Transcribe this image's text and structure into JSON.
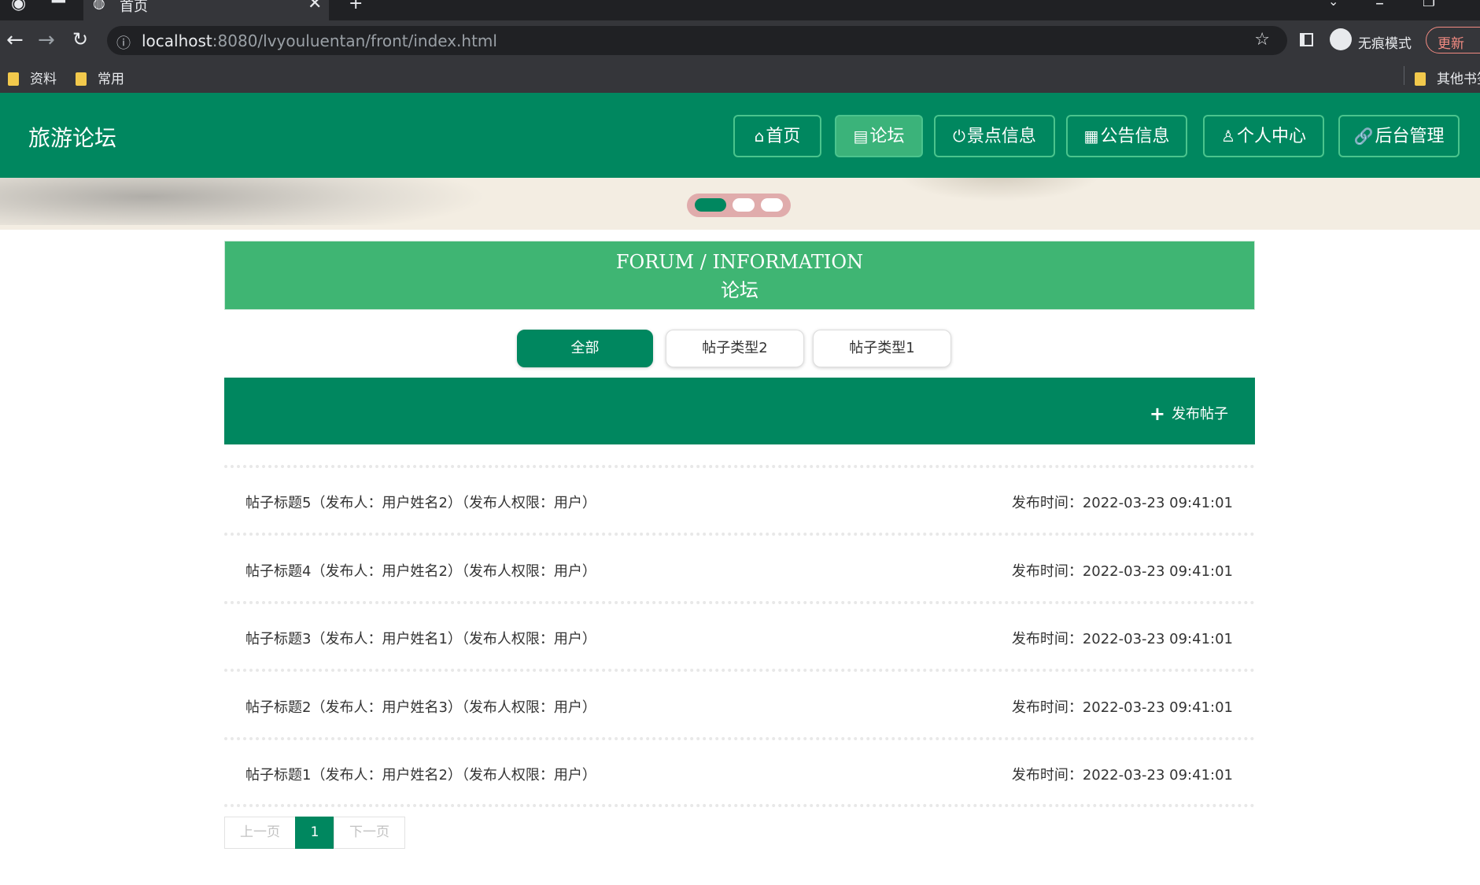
{
  "browser": {
    "tab_title": "首页",
    "url_host": "localhost",
    "url_path": ":8080/lvyouluentan/front/index.html",
    "incognito_label": "无痕模式",
    "update_label": "更新",
    "bookmarks": [
      "资料",
      "常用"
    ],
    "other_bookmarks": "其他书签"
  },
  "site": {
    "logo": "旅游论坛",
    "nav": [
      {
        "icon": "⌂",
        "label": "首页"
      },
      {
        "icon": "▤",
        "label": "论坛"
      },
      {
        "icon": "⏻",
        "label": "景点信息"
      },
      {
        "icon": "▦",
        "label": "公告信息"
      },
      {
        "icon": "♙",
        "label": "个人中心"
      },
      {
        "icon": "🔗",
        "label": "后台管理"
      }
    ],
    "active_nav": "论坛",
    "carousel_slide": 1
  },
  "section": {
    "title_en": "FORUM / INFORMATION",
    "title_cn": "论坛"
  },
  "categories": [
    "全部",
    "帖子类型2",
    "帖子类型1"
  ],
  "active_category": "全部",
  "post_button": "发布帖子",
  "posts": [
    {
      "text": "帖子标题5（发布人：用户姓名2）（发布人权限：用户）",
      "time": "发布时间：2022-03-23 09:41:01"
    },
    {
      "text": "帖子标题4（发布人：用户姓名2）（发布人权限：用户）",
      "time": "发布时间：2022-03-23 09:41:01"
    },
    {
      "text": "帖子标题3（发布人：用户姓名1）（发布人权限：用户）",
      "time": "发布时间：2022-03-23 09:41:01"
    },
    {
      "text": "帖子标题2（发布人：用户姓名3）（发布人权限：用户）",
      "time": "发布时间：2022-03-23 09:41:01"
    },
    {
      "text": "帖子标题1（发布人：用户姓名2）（发布人权限：用户）",
      "time": "发布时间：2022-03-23 09:41:01"
    }
  ],
  "pager": {
    "prev": "上一页",
    "current": "1",
    "next": "下一页"
  },
  "colors": {
    "brand": "#00875f",
    "accent": "#3fb573",
    "banner": "#f3ede2"
  }
}
